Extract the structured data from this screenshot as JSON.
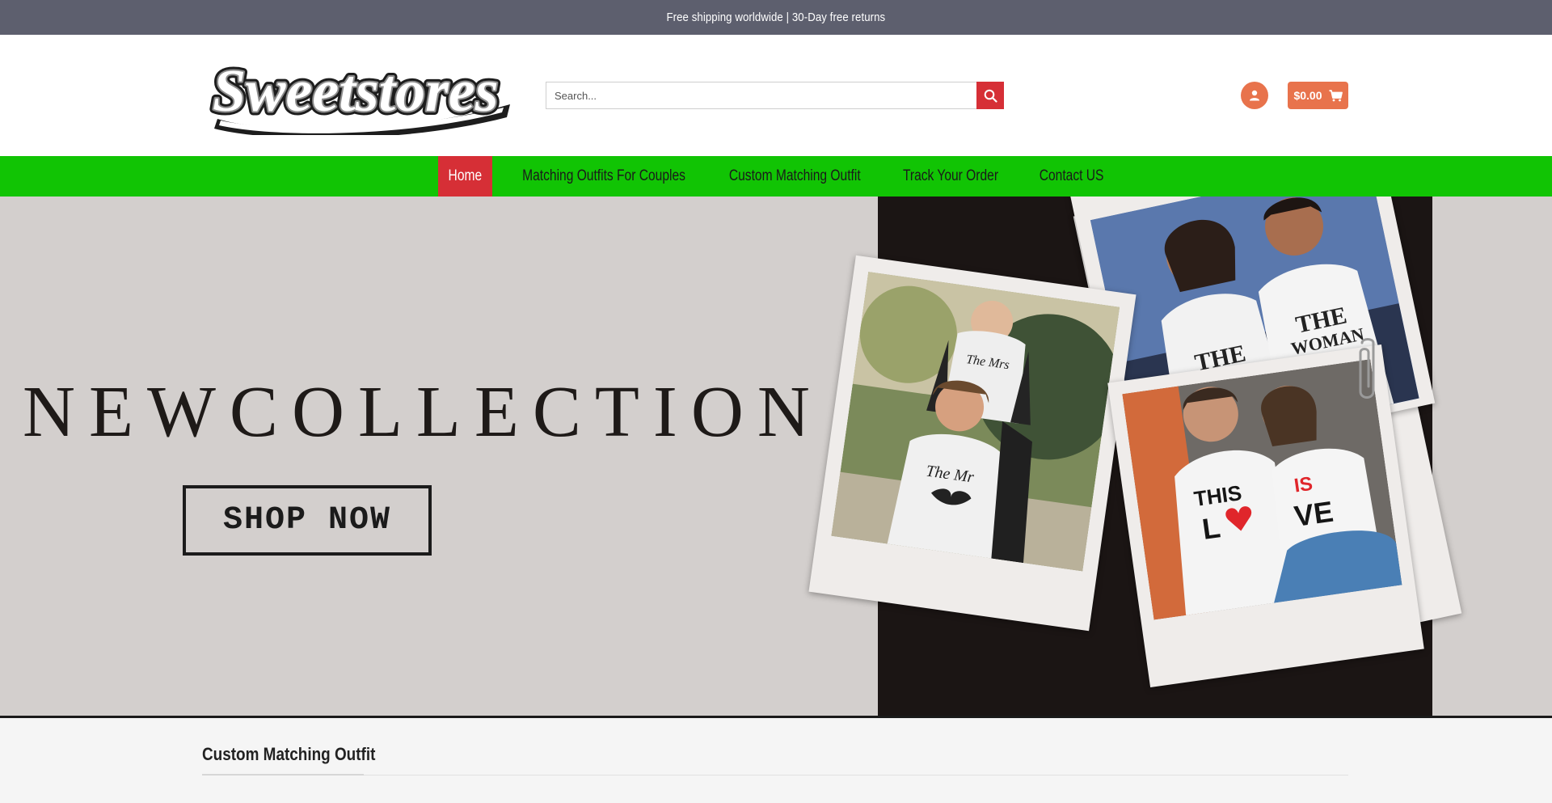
{
  "topbar": {
    "text": "Free shipping worldwide | 30-Day free returns"
  },
  "header": {
    "logo_text": "Sweetstores",
    "search": {
      "placeholder": "Search...",
      "value": ""
    },
    "cart": {
      "amount": "$0.00"
    }
  },
  "nav": {
    "items": [
      {
        "label": "Home",
        "active": true
      },
      {
        "label": "Matching Outfits For Couples"
      },
      {
        "label": "Custom Matching Outfit"
      },
      {
        "label": "Track Your Order"
      },
      {
        "label": "Contact US"
      }
    ]
  },
  "hero": {
    "title": "NEWCOLLECTION",
    "cta": "SHOP NOW",
    "shirt_texts": {
      "top_left_shirt": "THE MAN LOVES ME",
      "top_right_shirt": "THE WOMAN LOVES ME",
      "left_woman": "The Mrs",
      "left_man": "The Mr",
      "this": "THIS",
      "lo": "L",
      "is": "IS",
      "ve": "VE"
    }
  },
  "section": {
    "title": "Custom Matching Outfit"
  },
  "colors": {
    "topbar": "#5d5f6e",
    "nav": "#11c404",
    "accent_red": "#d62f36",
    "accent_orange": "#e8734c",
    "hero_bg": "#d3cfcd",
    "hero_dark": "#1b1514"
  },
  "icons": [
    "search-icon",
    "user-icon",
    "cart-icon"
  ]
}
